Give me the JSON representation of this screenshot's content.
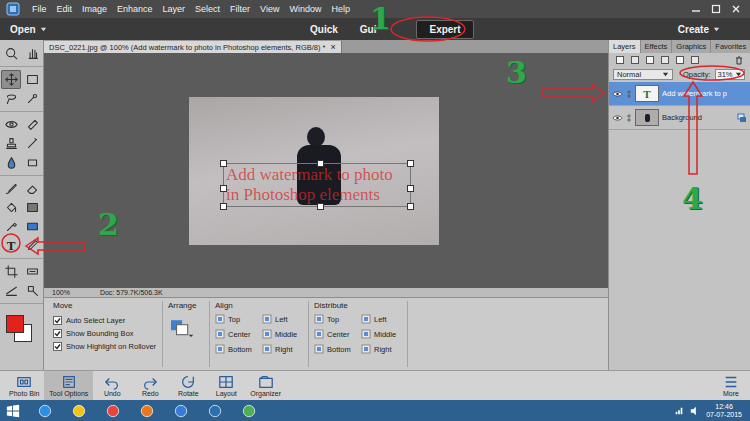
{
  "menu": {
    "items": [
      "File",
      "Edit",
      "Image",
      "Enhance",
      "Layer",
      "Select",
      "Filter",
      "View",
      "Window",
      "Help"
    ]
  },
  "mode_bar": {
    "open": "Open",
    "modes": [
      {
        "label": "Quick",
        "selected": false
      },
      {
        "label": "Gui",
        "selected": false
      },
      {
        "label": "Expert",
        "selected": true
      }
    ],
    "create": "Create"
  },
  "tool_groups": [
    {
      "tools": [
        {
          "kind": "zoom",
          "selected": false
        },
        {
          "kind": "hand",
          "selected": false
        }
      ]
    },
    {
      "tools": [
        {
          "kind": "move",
          "selected": true
        },
        {
          "kind": "marquee",
          "selected": false
        },
        {
          "kind": "lasso",
          "selected": false
        },
        {
          "kind": "quick-select",
          "selected": false
        }
      ]
    },
    {
      "tools": [
        {
          "kind": "red-eye",
          "selected": false
        },
        {
          "kind": "spot-heal",
          "selected": false
        },
        {
          "kind": "stamp",
          "selected": false
        },
        {
          "kind": "smart-brush",
          "selected": false
        },
        {
          "kind": "blur",
          "selected": false
        },
        {
          "kind": "sponge",
          "selected": false
        }
      ]
    },
    {
      "tools": [
        {
          "kind": "brush",
          "selected": false
        },
        {
          "kind": "eraser",
          "selected": false
        },
        {
          "kind": "bucket",
          "selected": false
        },
        {
          "kind": "gradient",
          "selected": false
        },
        {
          "kind": "eyedropper",
          "selected": false
        },
        {
          "kind": "shape",
          "selected": false
        },
        {
          "kind": "type",
          "glyph": "T",
          "selected": false
        },
        {
          "kind": "pencil",
          "selected": false
        }
      ]
    },
    {
      "tools": [
        {
          "kind": "crop",
          "selected": false
        },
        {
          "kind": "recompose",
          "selected": false
        },
        {
          "kind": "straighten",
          "selected": false
        },
        {
          "kind": "content-move",
          "selected": false
        }
      ]
    }
  ],
  "swatches": [
    {
      "name": "foreground",
      "color": "#e3211d"
    },
    {
      "name": "background",
      "color": "#ffffff"
    }
  ],
  "document": {
    "tab_title": "DSC_0221.jpg @ 100% (Add watermark to photo in Photoshop elements, RGB/8) *",
    "close": "×",
    "text_layer": "Add watermark to photo in Photoshop elements",
    "zoom": "100%",
    "doc_size": "Doc: 579.7K/506.3K"
  },
  "tool_options": {
    "title": "Move",
    "checkboxes": [
      {
        "label": "Auto Select Layer",
        "checked": true
      },
      {
        "label": "Show Bounding Box",
        "checked": true
      },
      {
        "label": "Show Highlight on Rollover",
        "checked": true
      }
    ],
    "arrange": {
      "title": "Arrange"
    },
    "align": {
      "title": "Align",
      "items": [
        "Top",
        "Left",
        "Center",
        "Middle",
        "Bottom",
        "Right"
      ]
    },
    "distribute": {
      "title": "Distribute",
      "items": [
        "Top",
        "Left",
        "Center",
        "Middle",
        "Bottom",
        "Right"
      ]
    }
  },
  "panels": {
    "tabs": [
      {
        "label": "Layers",
        "selected": true
      },
      {
        "label": "Effects",
        "selected": false
      },
      {
        "label": "Graphics",
        "selected": false
      },
      {
        "label": "Favorites",
        "selected": false
      }
    ],
    "blend_mode": "Normal",
    "opacity_label": "Opacity:",
    "opacity": "31%",
    "layers": [
      {
        "name": "Add watermark to p",
        "kind": "text",
        "thumb": "T",
        "selected": true,
        "visible": true
      },
      {
        "name": "Background",
        "kind": "image",
        "selected": false,
        "visible": true
      }
    ]
  },
  "bottom_bar": {
    "items": [
      {
        "label": "Photo Bin",
        "selected": false
      },
      {
        "label": "Tool Options",
        "selected": true
      },
      {
        "label": "Undo",
        "selected": false
      },
      {
        "label": "Redo",
        "selected": false
      },
      {
        "label": "Rotate",
        "selected": false
      },
      {
        "label": "Layout",
        "selected": false
      },
      {
        "label": "Organizer",
        "selected": false
      }
    ],
    "more": "More"
  },
  "taskbar": {
    "time": "12:46",
    "date": "07-07-2015"
  },
  "annotations": [
    {
      "label": "1"
    },
    {
      "label": "2"
    },
    {
      "label": "3"
    },
    {
      "label": "4"
    }
  ]
}
